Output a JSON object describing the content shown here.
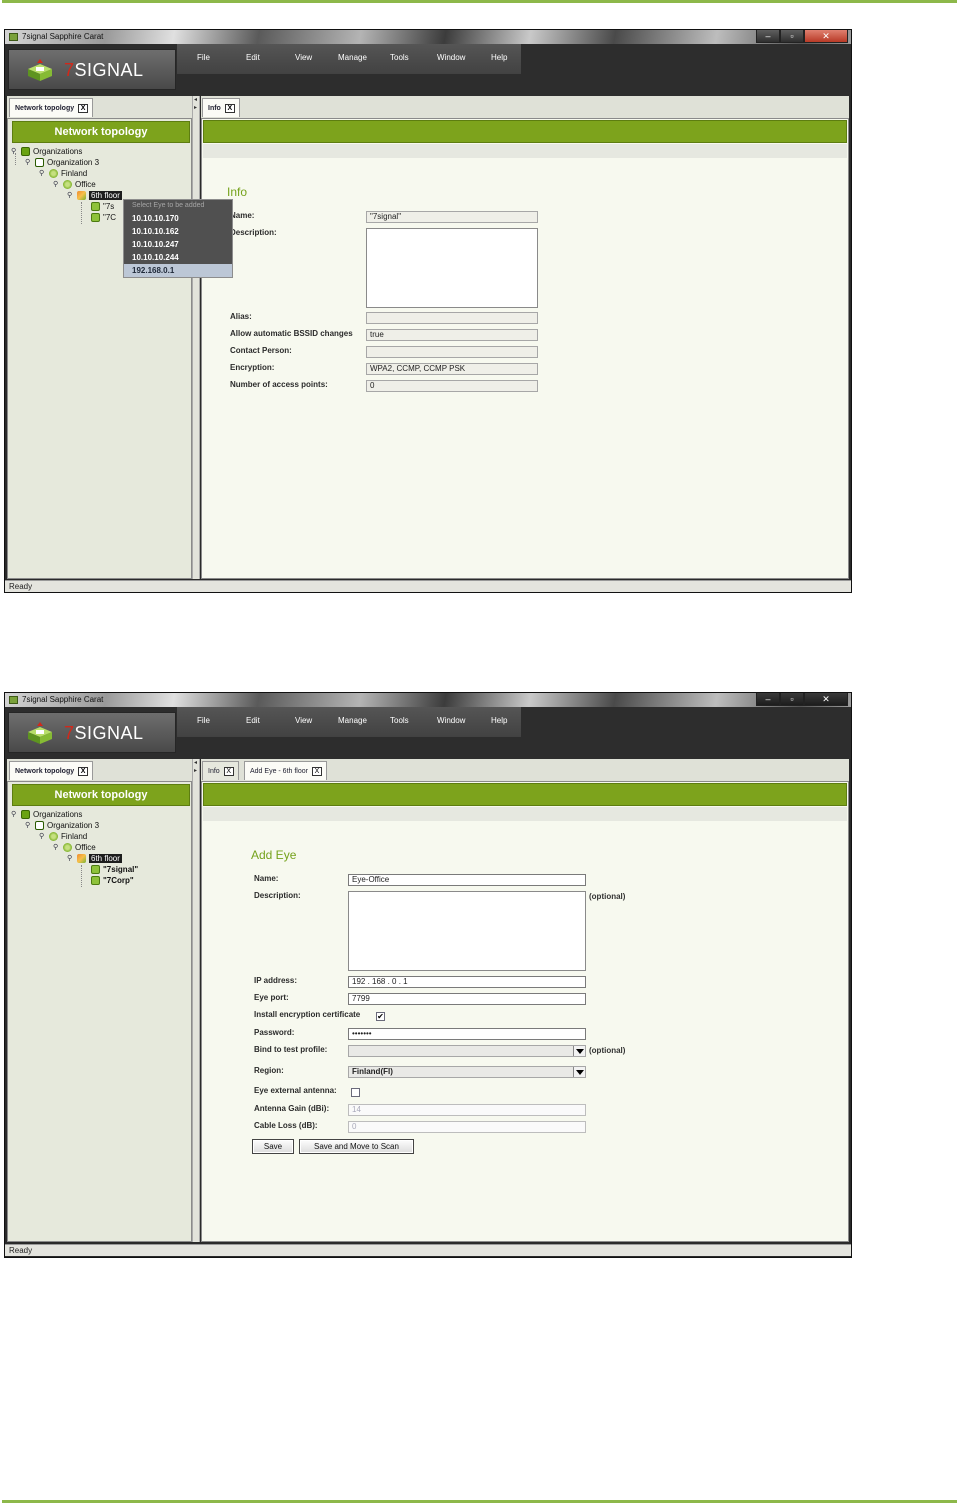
{
  "app": {
    "title": "7signal Sapphire Carat",
    "logo_seven": "7",
    "logo_word": "SIGNAL",
    "menu": [
      "File",
      "Edit",
      "View",
      "Manage",
      "Tools",
      "Window",
      "Help"
    ],
    "window_buttons": [
      "–",
      "▫",
      "✕"
    ]
  },
  "left_panel": {
    "tab_label": "Network topology",
    "tab_close": "X",
    "tree_header": "Network topology",
    "tree": {
      "organizations": "Organizations",
      "organization": "Organization 3",
      "country": "Finland",
      "site": "Office",
      "floor": "6th floor",
      "eye_1": "\"7signal\"",
      "eye_2": "\"7Corp\"",
      "eye_1_clipped": "\"7s",
      "eye_2_clipped": "\"7C"
    }
  },
  "screen1": {
    "tabs": [
      {
        "label": "Info",
        "close": "X"
      }
    ],
    "popup": {
      "title": "Select Eye to be added",
      "items": [
        "10.10.10.170",
        "10.10.10.162",
        "10.10.10.247",
        "10.10.10.244",
        "192.168.0.1"
      ],
      "highlighted_index": 4
    },
    "info": {
      "section_title": "Info",
      "name_label": "Name:",
      "name_value": "\"7signal\"",
      "description_label": "Description:",
      "alias_label": "Alias:",
      "alias_value": "",
      "auto_bssid_label": "Allow automatic BSSID changes",
      "auto_bssid_value": "true",
      "contact_label": "Contact Person:",
      "contact_value": "",
      "encryption_label": "Encryption:",
      "encryption_value": "WPA2, CCMP, CCMP PSK",
      "ap_count_label": "Number of access points:",
      "ap_count_value": "0"
    },
    "status": "Ready"
  },
  "screen2": {
    "tabs": [
      {
        "label": "Info",
        "close": "X"
      },
      {
        "label": "Add Eye - 6th floor",
        "close": "X"
      }
    ],
    "form": {
      "section_title": "Add Eye",
      "name_label": "Name:",
      "name_value": "Eye-Office",
      "description_label": "Description:",
      "description_optional": "(optional)",
      "ip_label": "IP address:",
      "ip_value": "192 . 168 . 0    . 1",
      "port_label": "Eye port:",
      "port_value": "7799",
      "install_cert_label": "Install encryption certificate",
      "install_cert_checked": true,
      "password_label": "Password:",
      "password_value": "•••••••",
      "bind_profile_label": "Bind to test profile:",
      "bind_profile_value": "",
      "bind_profile_optional": "(optional)",
      "region_label": "Region:",
      "region_value": "Finland(FI)",
      "ext_antenna_label": "Eye external antenna:",
      "ext_antenna_checked": false,
      "antenna_gain_label": "Antenna Gain (dBi):",
      "antenna_gain_value": "14",
      "cable_loss_label": "Cable Loss (dB):",
      "cable_loss_value": "0",
      "save_label": "Save",
      "save_scan_label": "Save and Move to Scan"
    },
    "status": "Ready"
  }
}
